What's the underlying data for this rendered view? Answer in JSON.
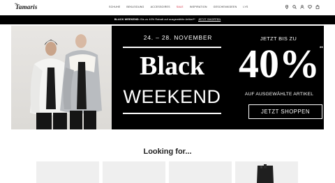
{
  "header": {
    "logo": "Tamaris",
    "nav": [
      "SCHUHE",
      "BEKLEIDUNG",
      "ACCESSOIRES",
      "SALE",
      "INSPIRATION",
      "GESCHENKIDEEN",
      "LYS"
    ],
    "icons": [
      "location-icon",
      "search-icon",
      "account-icon",
      "wishlist-icon",
      "cart-icon"
    ]
  },
  "promo": {
    "title": "BLACK WEEKEND:",
    "text": "Bis zu 40% Rabatt auf ausgewählte Artikel**",
    "link": "JETZT SHOPPEN"
  },
  "hero": {
    "dates": "24. – 28. NOVEMBER",
    "black": "Black",
    "weekend": "WEEKEND",
    "jetzt": "JETZT BIS ZU",
    "percent": "40%",
    "asterisk": "**",
    "auf": "AUF AUSGEWÄHLTE ARTIKEL",
    "cta": "JETZT SHOPPEN"
  },
  "section": {
    "title": "Looking for..."
  },
  "colors": {
    "sale": "#d0182f",
    "promo_bg": "#000000",
    "tile_bg": "#efefef"
  }
}
